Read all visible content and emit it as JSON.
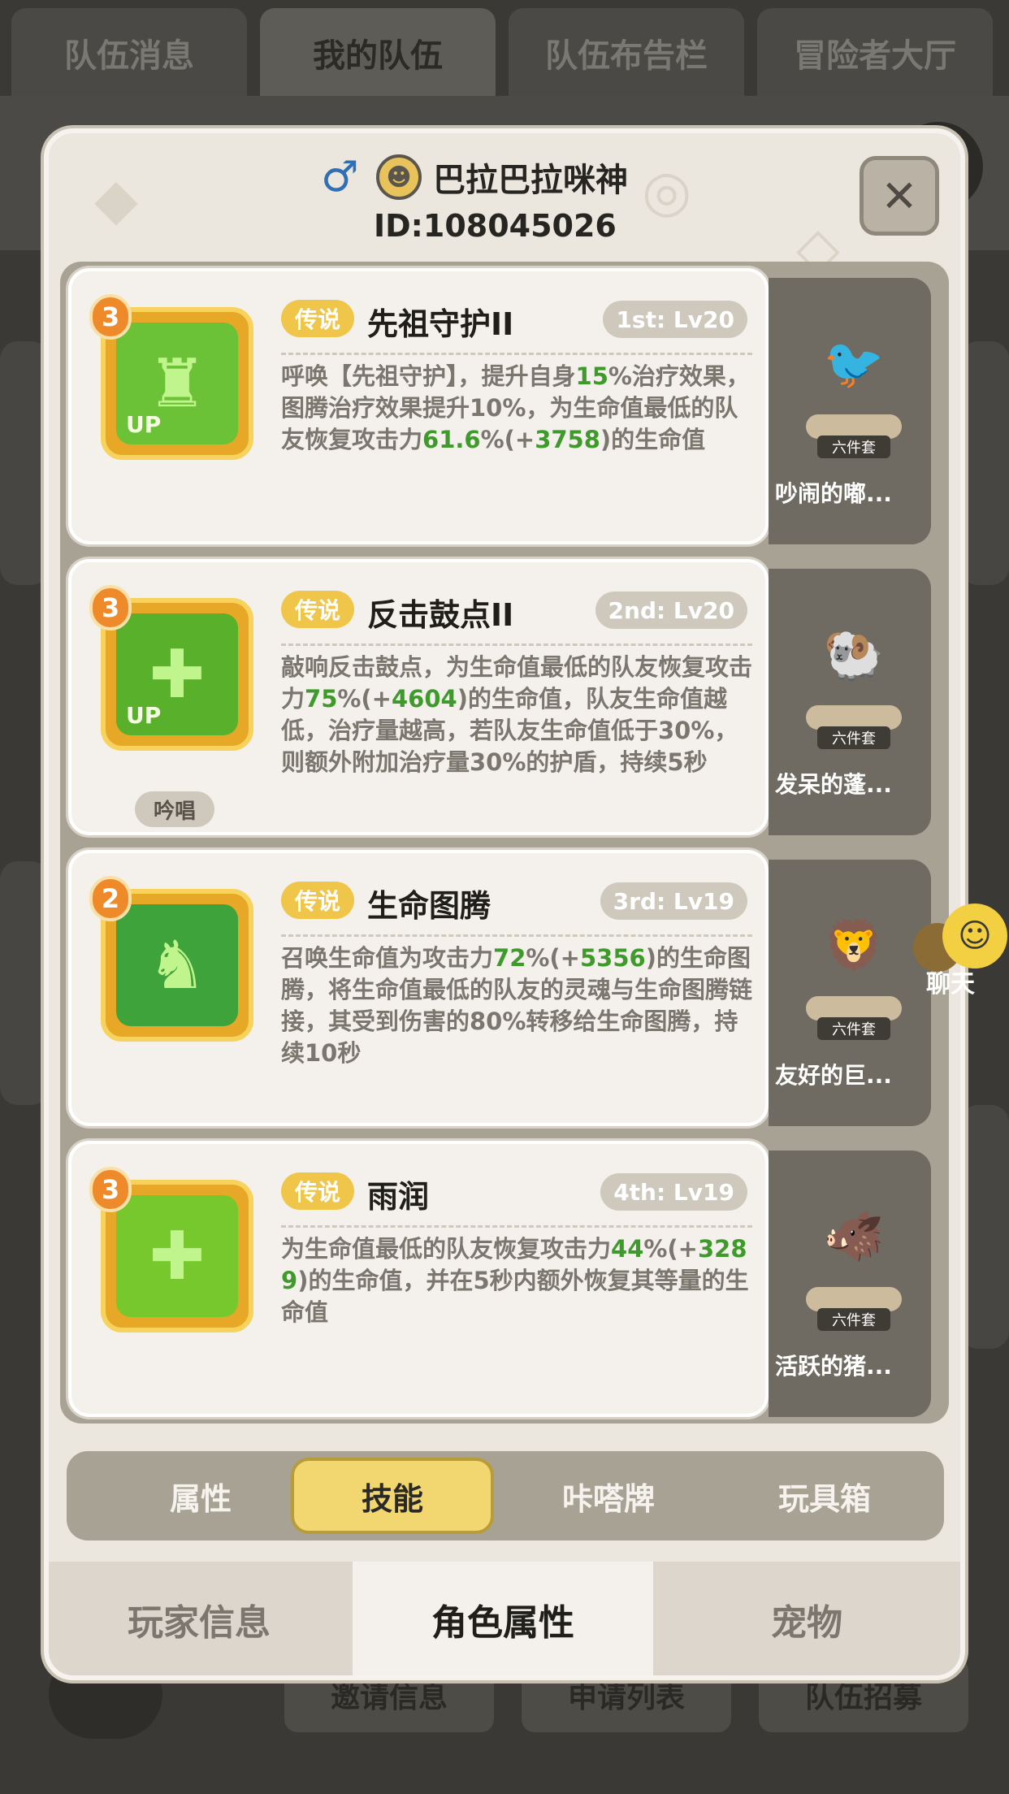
{
  "top_tabs": [
    "队伍消息",
    "我的队伍",
    "队伍布告栏",
    "冒险者大厅"
  ],
  "bottom_bg_buttons": [
    "邀请信息",
    "申请列表",
    "队伍招募"
  ],
  "player": {
    "name": "巴拉巴拉咪神",
    "id": "ID:108045026",
    "gender_icon": "♂"
  },
  "skills": [
    {
      "level": "3",
      "rarity": "传说",
      "name": "先祖守护II",
      "slot": "1st: Lv20",
      "upgraded": "UP",
      "chant": "",
      "desc": [
        {
          "t": "呼唤【先祖守护】，提升自身"
        },
        {
          "t": "15",
          "g": true
        },
        {
          "t": "%治疗效果，图腾治疗效果提升10%，为生命值最低的队友恢复攻击力"
        },
        {
          "t": "61.6",
          "g": true
        },
        {
          "t": "%(+"
        },
        {
          "t": "3758",
          "g": true
        },
        {
          "t": ")的生命值"
        }
      ]
    },
    {
      "level": "3",
      "rarity": "传说",
      "name": "反击鼓点II",
      "slot": "2nd: Lv20",
      "upgraded": "UP",
      "chant": "吟唱",
      "desc": [
        {
          "t": "敲响反击鼓点，为生命值最低的队友恢复攻击力"
        },
        {
          "t": "75",
          "g": true
        },
        {
          "t": "%(+"
        },
        {
          "t": "4604",
          "g": true
        },
        {
          "t": ")的生命值，队友生命值越低，治疗量越高，若队友生命值低于30%，则额外附加治疗量30%的护盾，持续5秒"
        }
      ]
    },
    {
      "level": "2",
      "rarity": "传说",
      "name": "生命图腾",
      "slot": "3rd: Lv19",
      "upgraded": "",
      "chant": "",
      "desc": [
        {
          "t": "召唤生命值为攻击力"
        },
        {
          "t": "72",
          "g": true
        },
        {
          "t": "%(+"
        },
        {
          "t": "5356",
          "g": true
        },
        {
          "t": ")的生命图腾，将生命值最低的队友的灵魂与生命图腾链接，其受到伤害的80%转移给生命图腾，持续10秒"
        }
      ]
    },
    {
      "level": "3",
      "rarity": "传说",
      "name": "雨润",
      "slot": "4th: Lv19",
      "upgraded": "",
      "chant": "",
      "desc": [
        {
          "t": "为生命值最低的队友恢复攻击力"
        },
        {
          "t": "44",
          "g": true
        },
        {
          "t": "%(+"
        },
        {
          "t": "3289",
          "g": true
        },
        {
          "t": ")的生命值，并在5秒内额外恢复其等量的生命值"
        }
      ]
    }
  ],
  "pets": [
    {
      "name": "吵闹的嘟...",
      "set": "六件套",
      "icon": "🐦"
    },
    {
      "name": "发呆的蓬...",
      "set": "六件套",
      "icon": "🐏"
    },
    {
      "name": "友好的巨...",
      "set": "六件套",
      "icon": "🦁"
    },
    {
      "name": "活跃的猪...",
      "set": "六件套",
      "icon": "🐗"
    }
  ],
  "sub_tabs": [
    "属性",
    "技能",
    "咔嗒牌",
    "玩具箱"
  ],
  "sub_tab_active": "技能",
  "bottom_tabs": [
    "玩家信息",
    "角色属性",
    "宠物"
  ],
  "bottom_tab_active": "角色属性",
  "chat": {
    "label": "聊天"
  },
  "colors": {
    "legend": "#f0c64a",
    "highlight_value": "#3f9a2c",
    "active_subtab": "#f2d770"
  }
}
